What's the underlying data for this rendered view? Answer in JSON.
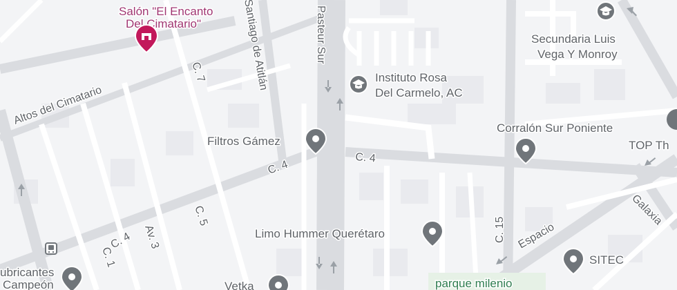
{
  "colors": {
    "background": "#f3f4f6",
    "major_road": "#d4d8de",
    "minor_road": "#ffffff",
    "pin_gray": "#70757a",
    "pin_pink": "#c2185b",
    "park_green": "#2e7d4f",
    "label_gray": "#5f6368"
  },
  "streets": {
    "pasteur": "Pasteur Sur",
    "santiago": "Santiago de Atitlán",
    "altos": "Altos del Cimatario",
    "c7": "C. 7",
    "c4_a": "C. 4",
    "c4_b": "C. 4",
    "c4_c": "C. 4",
    "av3": "Av. 3",
    "c5": "C. 5",
    "c1": "C. 1",
    "c15": "C. 15",
    "espacio": "Espacio",
    "galaxia": "Galaxia"
  },
  "places": {
    "salon_line1": "Salón \"El Encanto",
    "salon_line2": "Del Cimatario\"",
    "instituto_line1": "Instituto Rosa",
    "instituto_line2": "Del Carmelo, AC",
    "secundaria_line1": "Secundaria Luis",
    "secundaria_line2": "Vega Y Monroy",
    "corralon": "Corralón Sur Poniente",
    "top": "TOP Th",
    "filtros": "Filtros Gámez",
    "limo": "Limo Hummer Querétaro",
    "sitec": "SITEC",
    "parque": "parque milenio",
    "lubricantes_line1": "ubricantes",
    "lubricantes_line2": "Campeón",
    "vetka": "Vetka"
  },
  "icons": {
    "salon": "event-venue-icon",
    "instituto": "school-icon",
    "secundaria": "school-icon",
    "generic": "place-pin-icon",
    "bus": "bus-stop-icon",
    "arrow": "one-way-arrow-icon"
  }
}
